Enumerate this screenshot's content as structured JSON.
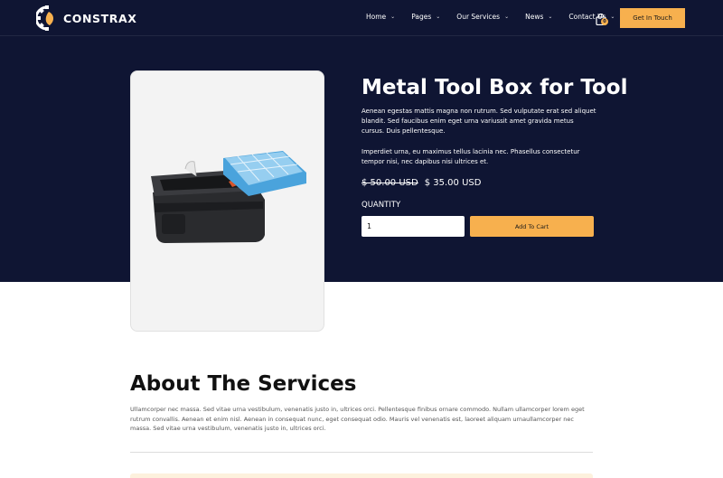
{
  "brand": {
    "name": "CONSTRAX"
  },
  "nav": {
    "items": [
      {
        "label": "Home",
        "icon": "chevron-down-icon"
      },
      {
        "label": "Pages",
        "icon": "chevron-down-icon"
      },
      {
        "label": "Our Services",
        "icon": "chevron-down-icon"
      },
      {
        "label": "News",
        "icon": "chevron-down-icon"
      },
      {
        "label": "Contact Us",
        "icon": "chevron-down-icon"
      }
    ],
    "cart_icon": "shopping-bag-icon",
    "cart_count": "0",
    "cta_label": "Get In Touch"
  },
  "product": {
    "title": "Metal Tool Box for Tool",
    "description_1": "Aenean egestas mattis magna non rutrum. Sed vulputate erat sed aliquet blandit. Sed faucibus enim eget urna variussit amet gravida metus cursus. Duis pellentesque.",
    "description_2": "Imperdiet urna, eu maximus tellus lacinia nec. Phasellus consectetur tempor nisi, nec dapibus nisi ultrices et.",
    "old_price": "$ 50.00 USD",
    "price": "$ 35.00 USD",
    "quantity_label": "QUANTITY",
    "quantity_value": "1",
    "add_to_cart_label": "Add To Cart"
  },
  "about": {
    "title": "About The Services",
    "text": "Ullamcorper nec massa. Sed vitae urna vestibulum, venenatis justo in, ultrices orci. Pellentesque finibus ornare commodo. Nullam ullamcorper lorem eget rutrum convallis. Aenean et enim nisl. Aenean in consequat nunc, eget consequat odio. Mauris vel venenatis est, laoreet aliquam urnaullamcorper nec massa. Sed vitae urna vestibulum, venenatis justo in, ultrices orci."
  },
  "colors": {
    "hero_bg": "#0f1533",
    "accent": "#f7b04e",
    "white": "#ffffff"
  }
}
